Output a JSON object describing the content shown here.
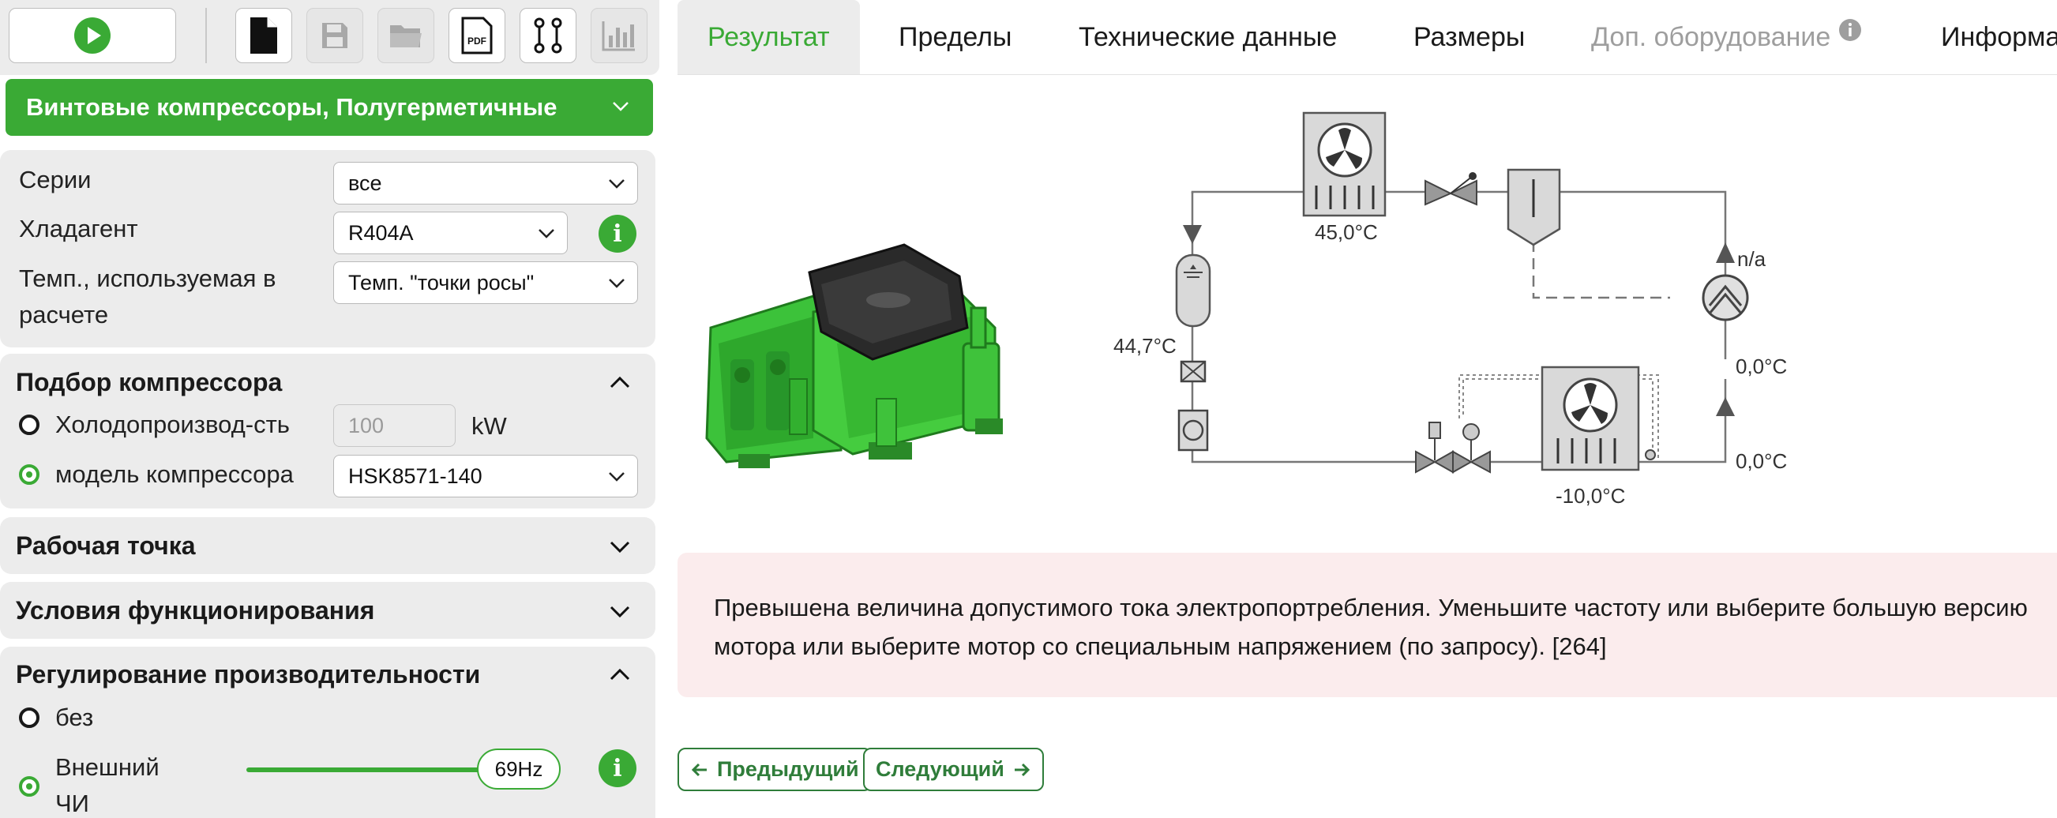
{
  "toolbar": {
    "icons": [
      "play-icon",
      "new-document-icon",
      "save-icon",
      "open-folder-icon",
      "pdf-icon",
      "schema-icon",
      "chart-icon"
    ],
    "pdf_label": "PDF"
  },
  "product_category": {
    "label": "Винтовые компрессоры, Полугерметичные"
  },
  "settings": {
    "series_label": "Серии",
    "series_value": "все",
    "refrigerant_label": "Хладагент",
    "refrigerant_value": "R404A",
    "temp_label_line1": "Темп., используемая в",
    "temp_label_line2": "расчете",
    "temp_value": "Темп. \"точки росы\""
  },
  "selection": {
    "title": "Подбор компрессора",
    "capacity_label": "Холодопроизвод-сть",
    "capacity_placeholder": "100",
    "capacity_unit": "kW",
    "model_label": "модель компрессора",
    "model_value": "HSK8571-140"
  },
  "sections": {
    "working_point": "Рабочая точка",
    "operating_conditions": "Условия функционирования"
  },
  "capacity_control": {
    "title": "Регулирование производительности",
    "option_none": "без",
    "option_external_line1": "Внешний",
    "option_external_line2": "ЧИ",
    "slider_value": "69Hz",
    "slider_fraction": 1.0
  },
  "tabs": [
    {
      "label": "Результат",
      "state": "active"
    },
    {
      "label": "Пределы",
      "state": "normal"
    },
    {
      "label": "Технические данные",
      "state": "normal"
    },
    {
      "label": "Размеры",
      "state": "normal"
    },
    {
      "label": "Доп. оборудование",
      "state": "disabled"
    },
    {
      "label": "Информа",
      "state": "normal"
    }
  ],
  "diagram": {
    "condenser_temp": "45,0°C",
    "liquid_temp": "44,7°C",
    "evaporator_temp": "-10,0°C",
    "suction_temp_1": "0,0°C",
    "suction_temp_2": "0,0°C",
    "discharge_label": "n/a"
  },
  "warning": {
    "line1": "Превышена величина допустимого тока электропортребления. Уменьшите частоту или выберите большую версию",
    "line2": "мотора или выберите мотор со специальным напряжением (по запросу). [264]"
  },
  "navigation": {
    "previous": "Предыдущий",
    "next": "Следующий"
  },
  "colors": {
    "accent": "#3aaa35",
    "nav": "#2f7d3a",
    "warning_bg": "#fbeced",
    "panel_bg": "#ececec"
  }
}
